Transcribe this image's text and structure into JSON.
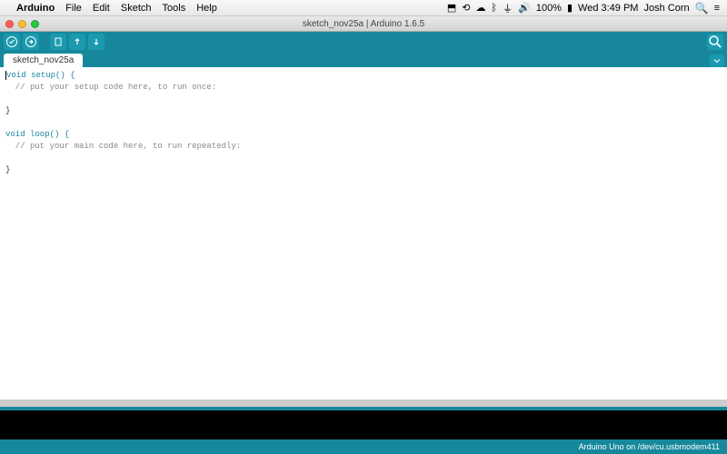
{
  "menubar": {
    "app_name": "Arduino",
    "items": [
      "File",
      "Edit",
      "Sketch",
      "Tools",
      "Help"
    ],
    "clock": "Wed 3:49 PM",
    "user": "Josh Corn",
    "battery": "100%"
  },
  "window": {
    "title": "sketch_nov25a | Arduino 1.6.5"
  },
  "toolbar": {
    "verify": "Verify",
    "upload": "Upload",
    "new": "New",
    "open": "Open",
    "save": "Save",
    "serial_monitor": "Serial Monitor"
  },
  "tabs": [
    {
      "label": "sketch_nov25a"
    }
  ],
  "code": {
    "setup_sig": "void",
    "setup_name": " setup() {",
    "setup_comment": "  // put your setup code here, to run once:",
    "loop_sig": "void",
    "loop_name": " loop() {",
    "loop_comment": "  // put your main code here, to run repeatedly:",
    "brace_close": "}"
  },
  "status": {
    "board_port": "Arduino Uno on /dev/cu.usbmodem411"
  }
}
